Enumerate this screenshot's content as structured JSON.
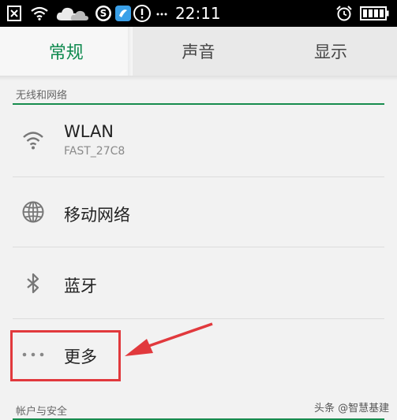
{
  "status_bar": {
    "time": "22:11",
    "icons": [
      "close-box-icon",
      "wifi-icon",
      "cloud-icon",
      "s-app-icon",
      "browser-app-icon",
      "alert-icon",
      "more-icon",
      "alarm-icon",
      "battery-icon"
    ]
  },
  "tabs": [
    {
      "label": "常规",
      "active": true
    },
    {
      "label": "声音",
      "active": false
    },
    {
      "label": "显示",
      "active": false
    }
  ],
  "sections": [
    {
      "header": "无线和网络",
      "items": [
        {
          "title": "WLAN",
          "subtitle": "FAST_27C8",
          "icon": "wifi-icon"
        },
        {
          "title": "移动网络",
          "icon": "globe-icon"
        },
        {
          "title": "蓝牙",
          "icon": "bluetooth-icon"
        },
        {
          "title": "更多",
          "icon": "more-dots-icon"
        }
      ]
    },
    {
      "header": "帐户与安全"
    }
  ],
  "watermark": "头条 @智慧基建",
  "colors": {
    "accent": "#0f8a4f",
    "highlight": "#e1393d",
    "status_bar": "#000000"
  }
}
